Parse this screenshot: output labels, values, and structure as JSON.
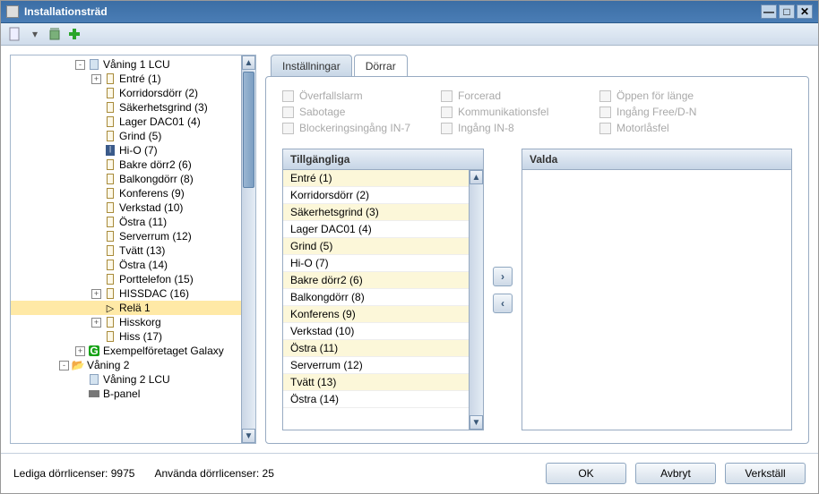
{
  "window": {
    "title": "Installationsträd"
  },
  "toolbar": {
    "new_icon": "new-icon",
    "dropdown_icon": "dropdown-icon",
    "delete_icon": "delete-icon",
    "add_icon": "add-icon"
  },
  "tree": [
    {
      "depth": 1,
      "expander": "-",
      "icon": "doc",
      "label": "Våning 1 LCU"
    },
    {
      "depth": 2,
      "expander": "+",
      "icon": "door",
      "label": "Entré (1)"
    },
    {
      "depth": 2,
      "expander": "",
      "icon": "door",
      "label": "Korridorsdörr (2)"
    },
    {
      "depth": 2,
      "expander": "",
      "icon": "door",
      "label": "Säkerhetsgrind (3)"
    },
    {
      "depth": 2,
      "expander": "",
      "icon": "door",
      "label": "Lager DAC01 (4)"
    },
    {
      "depth": 2,
      "expander": "",
      "icon": "door",
      "label": "Grind (5)"
    },
    {
      "depth": 2,
      "expander": "",
      "icon": "door-hi",
      "label": "Hi-O (7)"
    },
    {
      "depth": 2,
      "expander": "",
      "icon": "door",
      "label": "Bakre dörr2 (6)"
    },
    {
      "depth": 2,
      "expander": "",
      "icon": "door",
      "label": "Balkongdörr (8)"
    },
    {
      "depth": 2,
      "expander": "",
      "icon": "door",
      "label": "Konferens (9)"
    },
    {
      "depth": 2,
      "expander": "",
      "icon": "door",
      "label": "Verkstad (10)"
    },
    {
      "depth": 2,
      "expander": "",
      "icon": "door",
      "label": "Östra (11)"
    },
    {
      "depth": 2,
      "expander": "",
      "icon": "door",
      "label": "Serverrum (12)"
    },
    {
      "depth": 2,
      "expander": "",
      "icon": "door",
      "label": "Tvätt (13)"
    },
    {
      "depth": 2,
      "expander": "",
      "icon": "door",
      "label": "Östra (14)"
    },
    {
      "depth": 2,
      "expander": "",
      "icon": "door",
      "label": "Porttelefon (15)"
    },
    {
      "depth": 2,
      "expander": "+",
      "icon": "door",
      "label": "HISSDAC (16)"
    },
    {
      "depth": 2,
      "expander": "",
      "icon": "relay",
      "label": "Relä 1",
      "selected": true
    },
    {
      "depth": 2,
      "expander": "+",
      "icon": "hiss",
      "label": "Hisskorg"
    },
    {
      "depth": 2,
      "expander": "",
      "icon": "hiss",
      "label": "Hiss (17)"
    },
    {
      "depth": 1,
      "expander": "+",
      "icon": "green",
      "label": "Exempelföretaget Galaxy"
    },
    {
      "depth": 0,
      "expander": "-",
      "icon": "folder",
      "label": "Våning 2"
    },
    {
      "depth": 1,
      "expander": "",
      "icon": "doc",
      "label": "Våning 2 LCU"
    },
    {
      "depth": 1,
      "expander": "",
      "icon": "panel",
      "label": "B-panel"
    }
  ],
  "tabs": {
    "settings": "Inställningar",
    "doors": "Dörrar",
    "active": "doors"
  },
  "checkboxes": [
    "Överfallslarm",
    "Forcerad",
    "Öppen för länge",
    "Sabotage",
    "Kommunikationsfel",
    "Ingång Free/D-N",
    "Blockeringsingång IN-7",
    "Ingång IN-8",
    "Motorlåsfel"
  ],
  "available": {
    "header": "Tillgängliga",
    "items": [
      "Entré (1)",
      "Korridorsdörr (2)",
      "Säkerhetsgrind (3)",
      "Lager DAC01 (4)",
      "Grind (5)",
      "Hi-O (7)",
      "Bakre dörr2 (6)",
      "Balkongdörr (8)",
      "Konferens (9)",
      "Verkstad (10)",
      "Östra (11)",
      "Serverrum (12)",
      "Tvätt (13)",
      "Östra (14)"
    ]
  },
  "selected": {
    "header": "Valda",
    "items": []
  },
  "status": {
    "free_label": "Lediga dörrlicenser:",
    "free_value": "9975",
    "used_label": "Använda dörrlicenser:",
    "used_value": "25"
  },
  "buttons": {
    "ok": "OK",
    "cancel": "Avbryt",
    "apply": "Verkställ"
  }
}
